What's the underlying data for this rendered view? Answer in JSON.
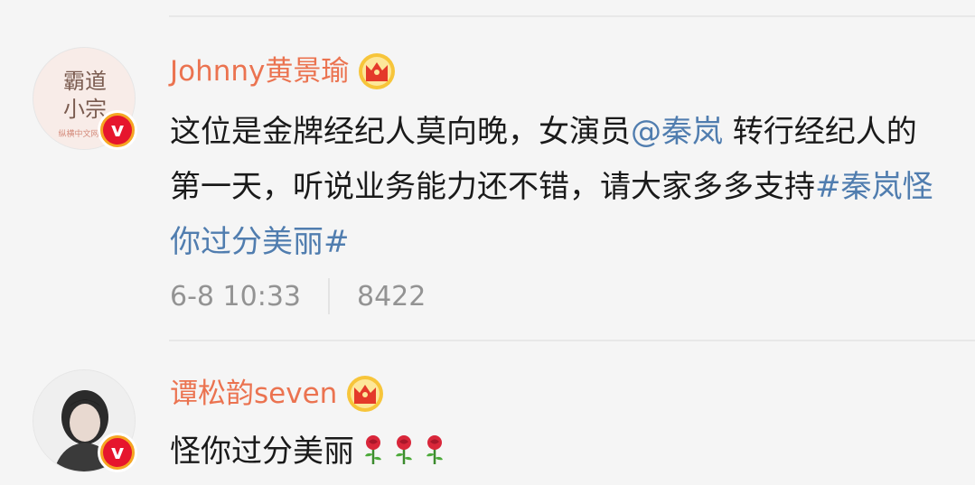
{
  "comments": [
    {
      "username": "Johnny黄景瑜",
      "avatar_text": [
        "霸道",
        "小宗",
        "纵横中文网"
      ],
      "text_plain_1": "这位是金牌经纪人莫向晚，女演员",
      "mention": "@秦岚",
      "text_plain_2": " 转行经纪人的第一天，听说业务能力还不错，请大家多多支持",
      "hashtag": "#秦岚怪你过分美丽#",
      "time": "6-8 10:33",
      "count": "8422",
      "verified_icon": "v-badge-icon",
      "crown_icon": "crown-icon"
    },
    {
      "username": "谭松韵seven",
      "text": "怪你过分美丽",
      "emoji": [
        "rose",
        "rose",
        "rose"
      ],
      "verified_icon": "v-badge-icon",
      "crown_icon": "crown-icon"
    }
  ],
  "colors": {
    "username": "#eb7350",
    "link": "#507daf",
    "meta": "#939393",
    "badge_red": "#e6162d",
    "badge_gold": "#f5a623"
  }
}
